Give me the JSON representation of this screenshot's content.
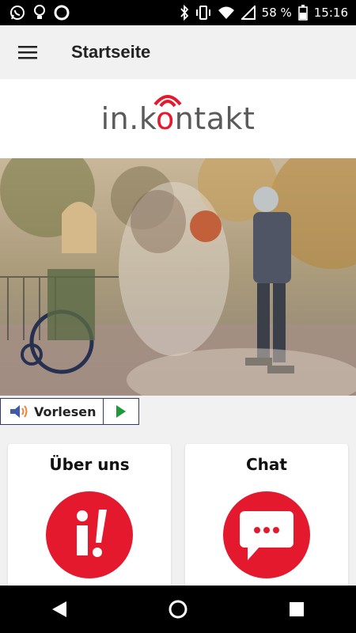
{
  "status_bar": {
    "battery_percent": "58 %",
    "time": "15:16",
    "left_icons": [
      "whatsapp-icon",
      "lightbulb-icon",
      "circle-app-icon"
    ],
    "right_icons": [
      "bluetooth-icon",
      "vibrate-icon",
      "wifi-icon",
      "signal-icon",
      "battery-icon"
    ]
  },
  "app_bar": {
    "title": "Startseite",
    "menu_icon": "hamburger-menu-icon"
  },
  "logo": {
    "text_before": "in.k",
    "text_o": "o",
    "text_after": "ntakt",
    "brand_color": "#e5192d"
  },
  "hero": {
    "description_icon": "hero-image"
  },
  "read_aloud": {
    "label": "Vorlesen",
    "speaker_icon": "speaker-icon",
    "play_icon": "play-icon"
  },
  "cards": [
    {
      "title": "Über uns",
      "icon": "info-icon"
    },
    {
      "title": "Chat",
      "icon": "chat-bubble-icon"
    }
  ],
  "nav_bar": {
    "icons": [
      "back-icon",
      "home-icon",
      "recents-icon"
    ]
  },
  "colors": {
    "accent": "#e5192d",
    "play_green": "#1f9a3a",
    "background": "#f1f1f1",
    "border_navy": "#2e3b6e"
  }
}
